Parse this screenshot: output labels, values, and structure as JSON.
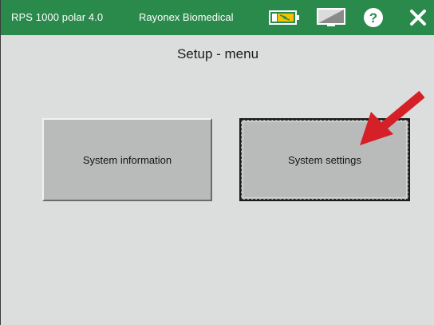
{
  "titlebar": {
    "app_name": "RPS 1000 polar 4.0",
    "company": "Rayonex Biomedical",
    "icons": [
      "battery-icon",
      "display-icon",
      "help-icon",
      "close-icon"
    ],
    "color": "#2a8a4c"
  },
  "screen": {
    "title": "Setup - menu"
  },
  "buttons": {
    "system_information": "System information",
    "system_settings": "System settings"
  },
  "annotation": {
    "arrow_color": "#d62027"
  }
}
